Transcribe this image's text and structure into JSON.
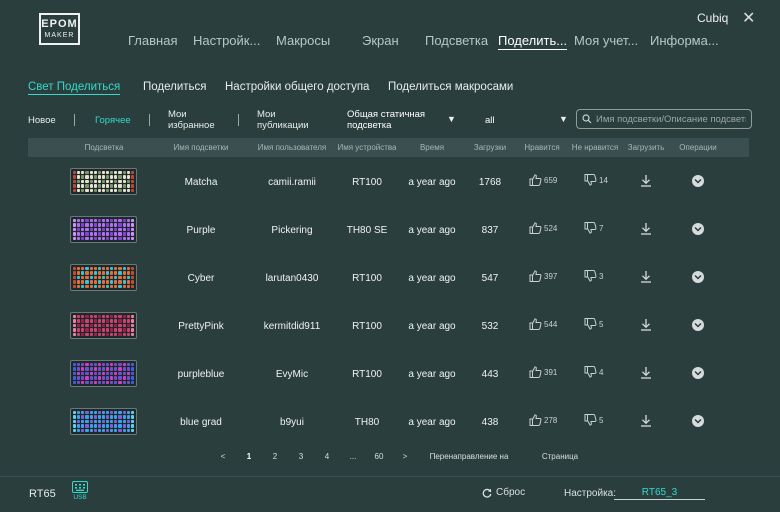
{
  "header": {
    "logo_line1": "EPOM",
    "logo_line2": "MAKER",
    "username": "Cubiq",
    "close_glyph": "✕",
    "nav": [
      {
        "label": "Главная"
      },
      {
        "label": "Настройк..."
      },
      {
        "label": "Макросы"
      },
      {
        "label": "Экран"
      },
      {
        "label": "Подсветка"
      },
      {
        "label": "Поделить..."
      },
      {
        "label": "Моя учет..."
      },
      {
        "label": "Информа..."
      }
    ],
    "active_nav": "Поделить..."
  },
  "subtabs": [
    {
      "label": "Свет Поделиться"
    },
    {
      "label": "Поделиться"
    },
    {
      "label": "Настройки общего доступа"
    },
    {
      "label": "Поделиться макросами"
    }
  ],
  "filters": {
    "new": "Новое",
    "hot": "Горячее",
    "favorites_line1": "Мои",
    "favorites_line2": "избранное",
    "publications_line1": "Мои",
    "publications_line2": "публикации",
    "type_line1": "Общая статичная",
    "type_line2": "подсветка",
    "device_filter": "all",
    "search_placeholder": "Имя подсветки/Описание подсветки"
  },
  "table": {
    "headers": [
      "Подсветка",
      "Имя подсветки",
      "Имя пользователя",
      "Имя устройства",
      "Время",
      "Загрузки",
      "Нравится",
      "Не нравится",
      "Загрузить",
      "Операции"
    ],
    "rows": [
      {
        "name": "Matcha",
        "user": "camii.ramii",
        "device": "RT100",
        "time": "a year ago",
        "downloads": "1768",
        "likes": "659",
        "dislikes": "14",
        "colors": [
          "#e8e0d0",
          "#7a9a6a",
          "#b84a3a"
        ]
      },
      {
        "name": "Purple",
        "user": "Pickering",
        "device": "TH80 SE",
        "time": "a year ago",
        "downloads": "837",
        "likes": "524",
        "dislikes": "7",
        "colors": [
          "#b070f0",
          "#8a40e0",
          "#d090ff"
        ]
      },
      {
        "name": "Cyber",
        "user": "larutan0430",
        "device": "RT100",
        "time": "a year ago",
        "downloads": "547",
        "likes": "397",
        "dislikes": "3",
        "colors": [
          "#e07040",
          "#40c0d0",
          "#c05030"
        ]
      },
      {
        "name": "PrettyPink",
        "user": "kermitdid911",
        "device": "RT100",
        "time": "a year ago",
        "downloads": "532",
        "likes": "544",
        "dislikes": "5",
        "colors": [
          "#d04070",
          "#a02050",
          "#f080a0"
        ]
      },
      {
        "name": "purpleblue",
        "user": "EvyMic",
        "device": "RT100",
        "time": "a year ago",
        "downloads": "443",
        "likes": "391",
        "dislikes": "4",
        "colors": [
          "#7050d0",
          "#d040c0",
          "#4060e0"
        ]
      },
      {
        "name": "blue grad",
        "user": "b9yui",
        "device": "TH80",
        "time": "a year ago",
        "downloads": "438",
        "likes": "278",
        "dislikes": "5",
        "colors": [
          "#40a0f0",
          "#8060e0",
          "#60d0f0"
        ]
      }
    ]
  },
  "pagination": {
    "prev": "<",
    "pages": [
      "1",
      "2",
      "3",
      "4",
      "...",
      "60"
    ],
    "current": "1",
    "next": ">",
    "goto_label": "Перенаправление на",
    "page_label": "Страница"
  },
  "footer": {
    "device": "RT65",
    "usb_label": "USB",
    "reset_label": "Сброс",
    "settings_label": "Настройка:",
    "settings_value": "RT65_3"
  },
  "colors": {
    "background": "#2b3e3e",
    "accent": "#35d9cc",
    "header_row": "#3a4f4f"
  }
}
